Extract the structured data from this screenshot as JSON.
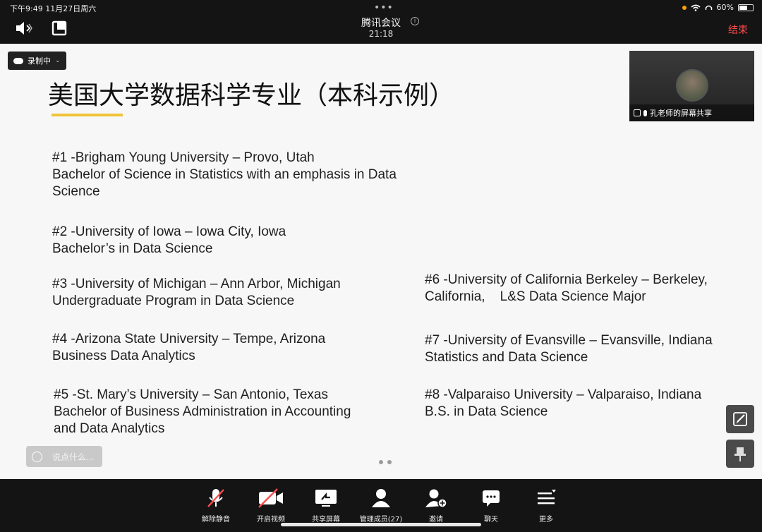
{
  "status_bar": {
    "time_date": "下午9:49  11月27日周六",
    "battery": "60%",
    "battery_level": 0.6
  },
  "meeting": {
    "title": "腾讯会议",
    "timer": "21:18",
    "end_label": "结束",
    "info": "i"
  },
  "recording": {
    "label": "录制中"
  },
  "slide": {
    "title": "美国大学数据科学专业（本科示例）",
    "entries": [
      [
        "#1 -Brigham Young University – Provo, Utah",
        "Bachelor of Science in Statistics with an emphasis in Data",
        "Science"
      ],
      [
        "#2 -University of Iowa – Iowa City, Iowa",
        "Bachelor’s in Data Science"
      ],
      [
        "#3 -University of Michigan – Ann Arbor, Michigan",
        "Undergraduate Program in Data Science"
      ],
      [
        "#4 -Arizona State University – Tempe, Arizona",
        "Business Data Analytics"
      ],
      [
        "#5 -St. Mary’s University – San Antonio, Texas",
        "Bachelor of Business Administration in Accounting",
        "and Data Analytics"
      ],
      [
        "#6 -University of California Berkeley – Berkeley,",
        "California,    L&S Data Science Major"
      ],
      [
        "#7 -University of Evansville – Evansville, Indiana",
        "Statistics and Data Science"
      ],
      [
        "#8 -Valparaiso University – Valparaiso, Indiana",
        "B.S. in Data Science"
      ]
    ]
  },
  "video": {
    "label": "孔老师的屏幕共享"
  },
  "chat": {
    "placeholder": "说点什么..."
  },
  "toolbar": {
    "unmute": "解除静音",
    "video": "开启视频",
    "share": "共享屏幕",
    "members": "管理成员(27)",
    "invite": "邀请",
    "chat": "聊天",
    "more": "更多"
  },
  "colors": {
    "end": "#ff4d4f",
    "accent_underline": "#f0c43a",
    "toolbar_bg": "#141414"
  }
}
